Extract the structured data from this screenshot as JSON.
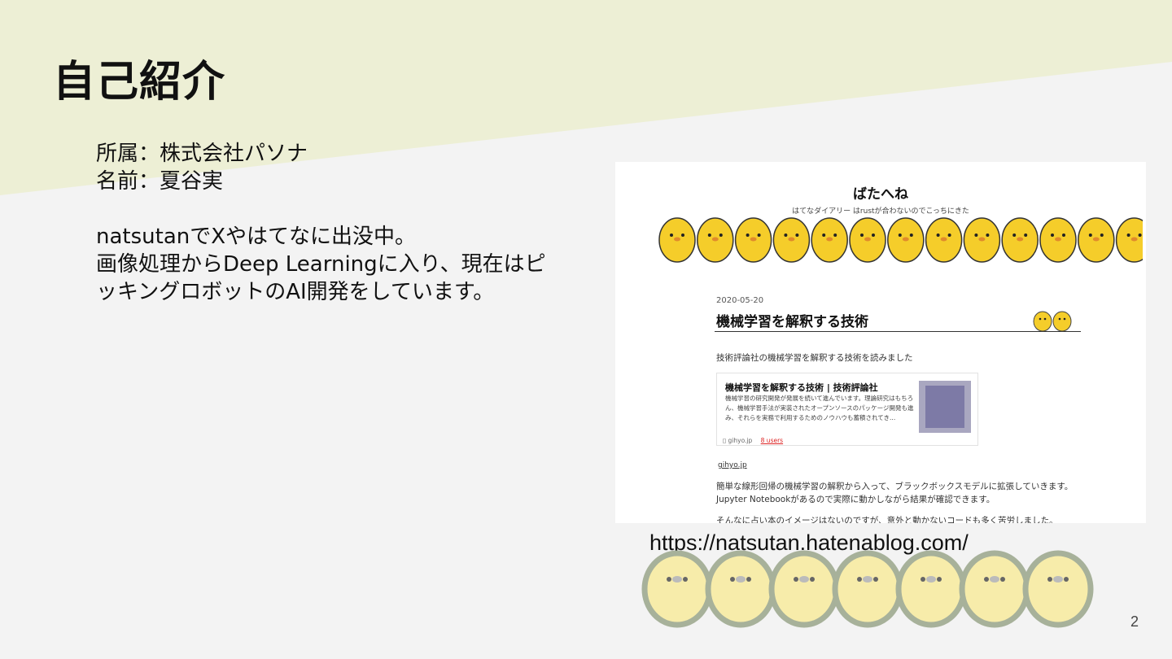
{
  "slide": {
    "title": "自己紹介",
    "affiliation": "所属：株式会社パソナ",
    "name": "名前：夏谷実",
    "intro_lines": [
      "natsutanでXやはてなに出没中。",
      "画像処理からDeep Learningに入り、現在はピ",
      "ッキングロボットのAI開発をしています。"
    ],
    "url": "https://natsutan.hatenablog.com/",
    "page_number": "2"
  },
  "blog": {
    "title": "ばたへね",
    "subtitle": "はてなダイアリー はrustが合わないのでこっちにきた",
    "date": "2020-05-20",
    "post_title": "機械学習を解釈する技術",
    "lead": "技術評論社の機械学習を解釈する技術を読みました",
    "card": {
      "title": "機械学習を解釈する技術 | 技術評論社",
      "desc": "機械学習の研究開発が発展を続いて進んでいます。理論研究はもちろん、機械学習手法が実装されたオープンソースのパッケージ開発も進み、それらを実務で利用するためのノウハウも蓄積されてき...",
      "source": "gihyo.jp",
      "bookmarks": "8 users"
    },
    "link": "gihyo.jp",
    "body": [
      "簡単な線形回帰の機械学習の解釈から入って、ブラックボックスモデルに拡張していきます。",
      "Jupyter Notebookがあるので実際に動かしながら結果が確認できます。",
      "そんなに占い本のイメージはないのですが、意外と動かないコードも多く苦労しました。"
    ]
  },
  "colors": {
    "band": "#edefd5",
    "chick_yellow": "#f5cd2a",
    "chick_pale": "#f7ecaa",
    "chick_outline": "#a7b19a"
  }
}
